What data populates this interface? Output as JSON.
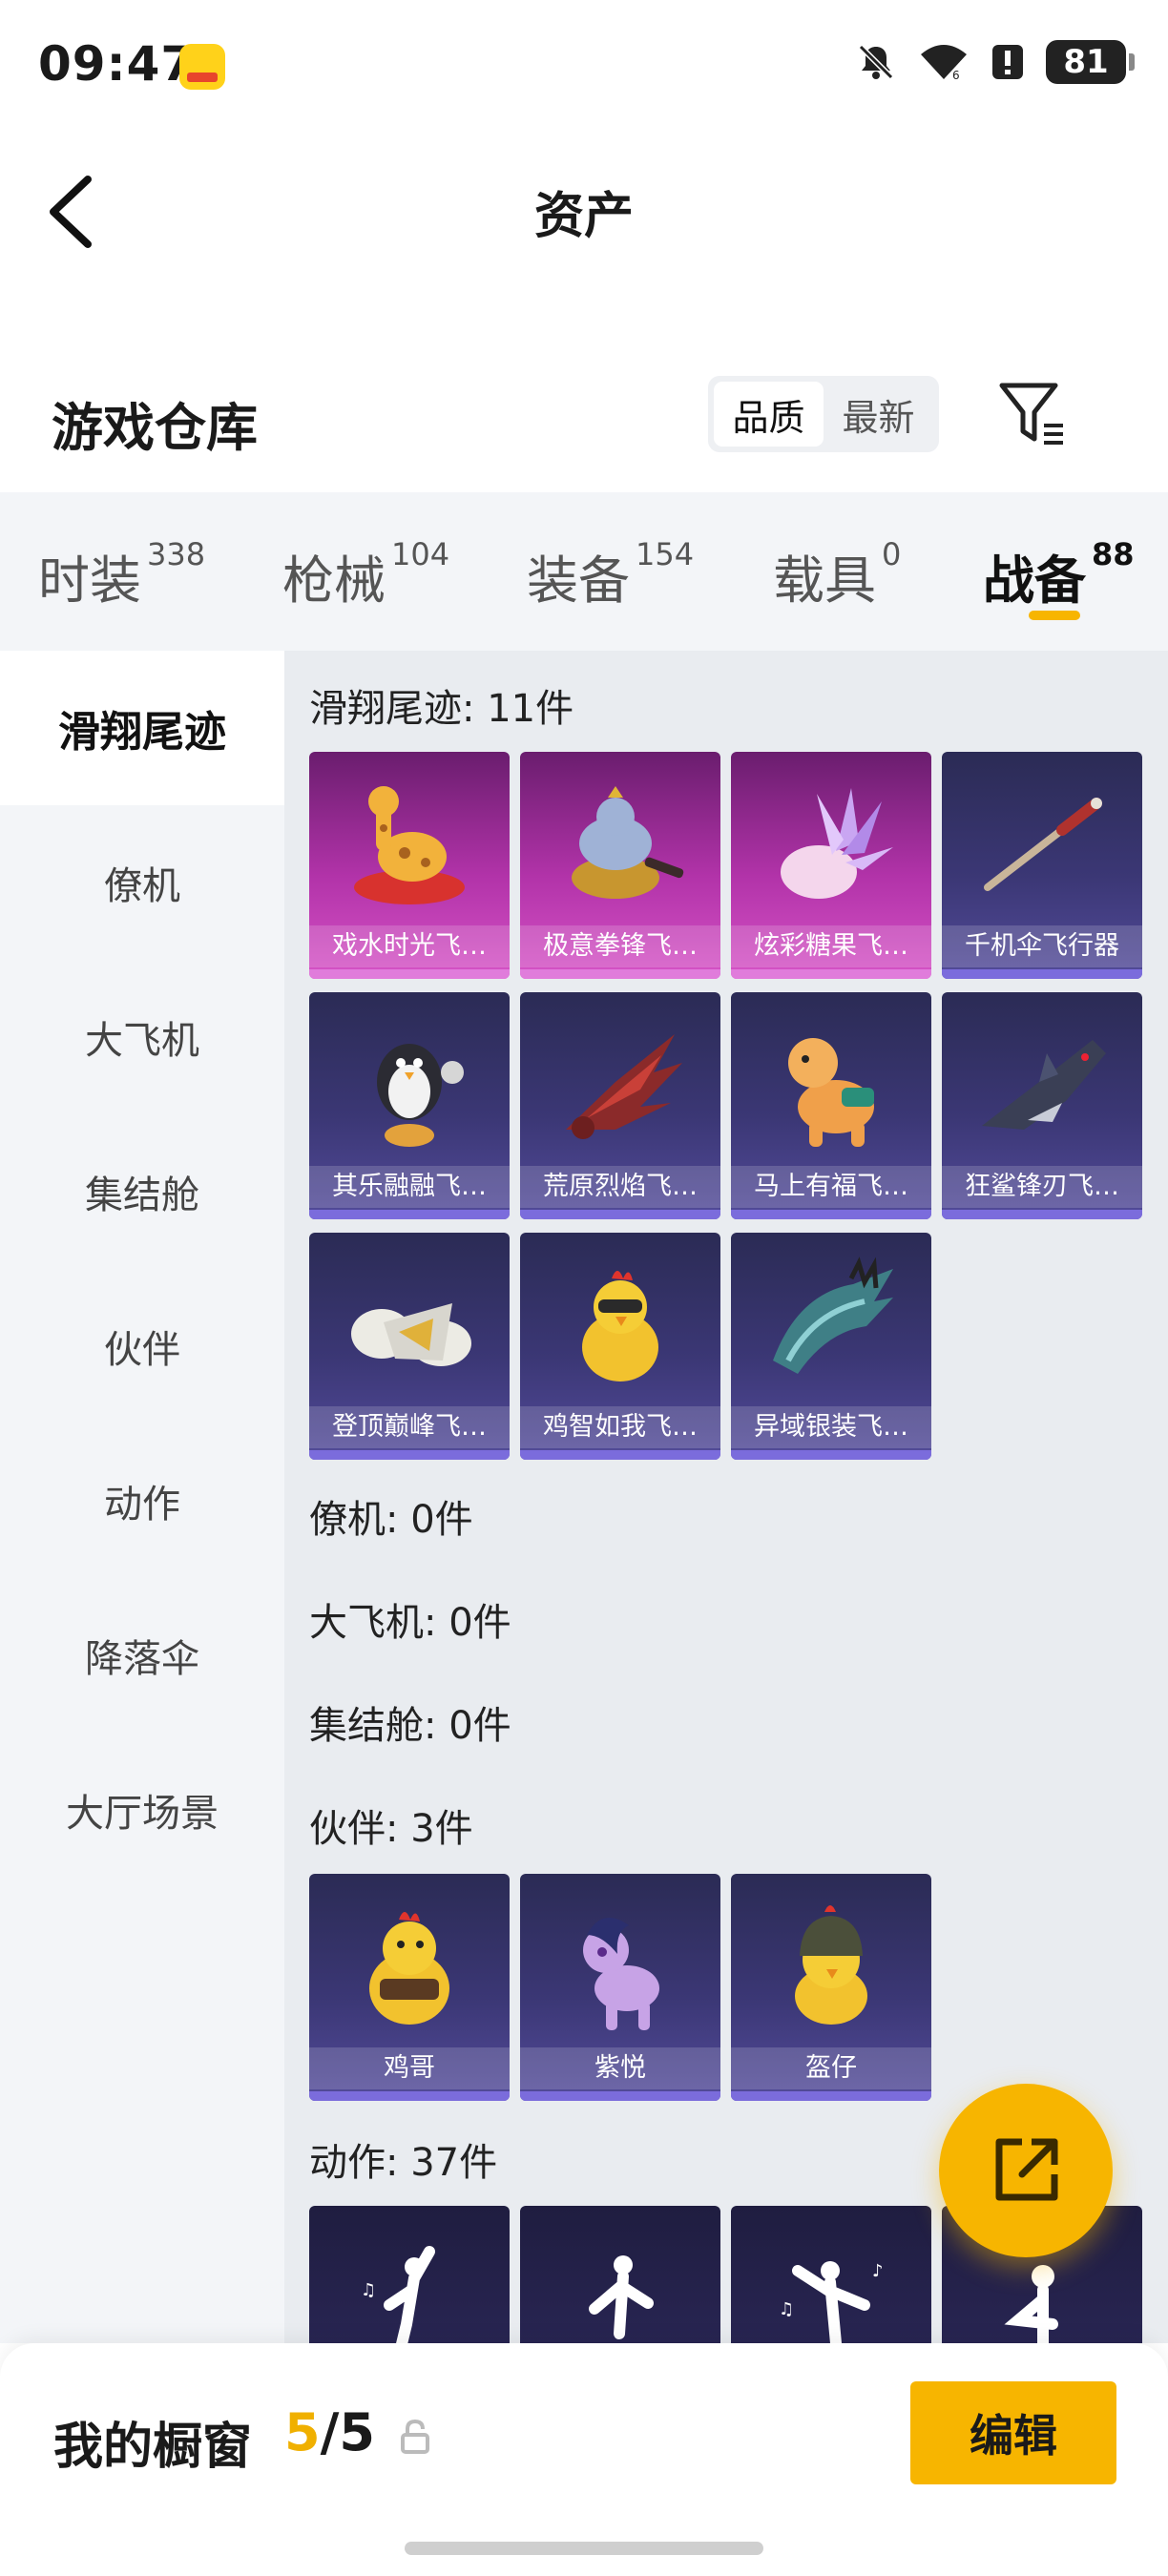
{
  "status_bar": {
    "time": "09:47",
    "battery": "81"
  },
  "nav": {
    "title": "资产"
  },
  "header": {
    "title": "游戏仓库",
    "sort_options": [
      "品质",
      "最新"
    ],
    "active_sort": "品质"
  },
  "category_tabs": [
    {
      "label": "时装",
      "count": "338"
    },
    {
      "label": "枪械",
      "count": "104"
    },
    {
      "label": "装备",
      "count": "154"
    },
    {
      "label": "载具",
      "count": "0"
    },
    {
      "label": "战备",
      "count": "88",
      "active": true
    }
  ],
  "sidebar": {
    "items": [
      "滑翔尾迹",
      "僚机",
      "大飞机",
      "集结舱",
      "伙伴",
      "动作",
      "降落伞",
      "大厅场景"
    ],
    "active": "滑翔尾迹"
  },
  "sections": [
    {
      "title": "滑翔尾迹: 11件",
      "items": [
        {
          "label": "戏水时光飞…",
          "rarity": "pink",
          "icon": "giraffe-toy"
        },
        {
          "label": "极意拳锋飞…",
          "rarity": "pink",
          "icon": "elephant-glider"
        },
        {
          "label": "炫彩糖果飞…",
          "rarity": "pink",
          "icon": "candy-crystal"
        },
        {
          "label": "千机伞飞行器",
          "rarity": "purple",
          "icon": "umbrella-staff"
        },
        {
          "label": "其乐融融飞…",
          "rarity": "purple",
          "icon": "penguin-balloon"
        },
        {
          "label": "荒原烈焰飞…",
          "rarity": "purple",
          "icon": "flame-wings"
        },
        {
          "label": "马上有福飞…",
          "rarity": "purple",
          "icon": "horse-toy"
        },
        {
          "label": "狂鲨锋刃飞…",
          "rarity": "purple",
          "icon": "shark-blade"
        },
        {
          "label": "登顶巅峰飞…",
          "rarity": "purple",
          "icon": "jet-glider"
        },
        {
          "label": "鸡智如我飞…",
          "rarity": "purple",
          "icon": "chicken-pilot"
        },
        {
          "label": "异域银装飞…",
          "rarity": "purple",
          "icon": "silver-wings"
        }
      ]
    },
    {
      "title": "僚机: 0件",
      "items": []
    },
    {
      "title": "大飞机: 0件",
      "items": []
    },
    {
      "title": "集结舱: 0件",
      "items": []
    },
    {
      "title": "伙伴: 3件",
      "items": [
        {
          "label": "鸡哥",
          "rarity": "purple",
          "icon": "chicken-buddy"
        },
        {
          "label": "紫悦",
          "rarity": "purple",
          "icon": "purple-pony"
        },
        {
          "label": "盔仔",
          "rarity": "purple",
          "icon": "helmet-chick"
        }
      ]
    },
    {
      "title": "动作: 37件",
      "items": [
        {
          "label": "",
          "rarity": "purple",
          "icon": "dance-pose"
        },
        {
          "label": "",
          "rarity": "purple",
          "icon": "dance-pose"
        },
        {
          "label": "",
          "rarity": "purple",
          "icon": "dance-pose"
        },
        {
          "label": "",
          "rarity": "purple",
          "icon": "dance-pose"
        }
      ]
    }
  ],
  "showcase": {
    "label": "我的橱窗",
    "current": "5",
    "total": "5",
    "edit_label": "编辑"
  },
  "colors": {
    "accent": "#f7b500",
    "rarity_pink": "#c23fb8",
    "rarity_purple": "#3d3878"
  }
}
